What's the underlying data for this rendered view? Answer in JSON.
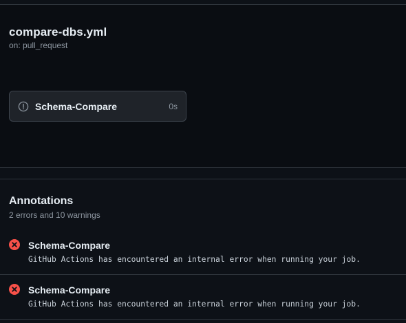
{
  "workflow": {
    "file_name": "compare-dbs.yml",
    "trigger": "on: pull_request",
    "job": {
      "name": "Schema-Compare",
      "duration": "0s",
      "status_icon": "skipped-circle-icon"
    }
  },
  "annotations": {
    "title": "Annotations",
    "summary": "2 errors and 10 warnings",
    "items": [
      {
        "title": "Schema-Compare",
        "message": "GitHub Actions has encountered an internal error when running your job.",
        "icon": "error-circle-icon"
      },
      {
        "title": "Schema-Compare",
        "message": "GitHub Actions has encountered an internal error when running your job.",
        "icon": "error-circle-icon"
      }
    ]
  },
  "colors": {
    "background": "#0d1117",
    "error": "#f85149",
    "muted_text": "#8d96a0",
    "border": "#30363d"
  }
}
